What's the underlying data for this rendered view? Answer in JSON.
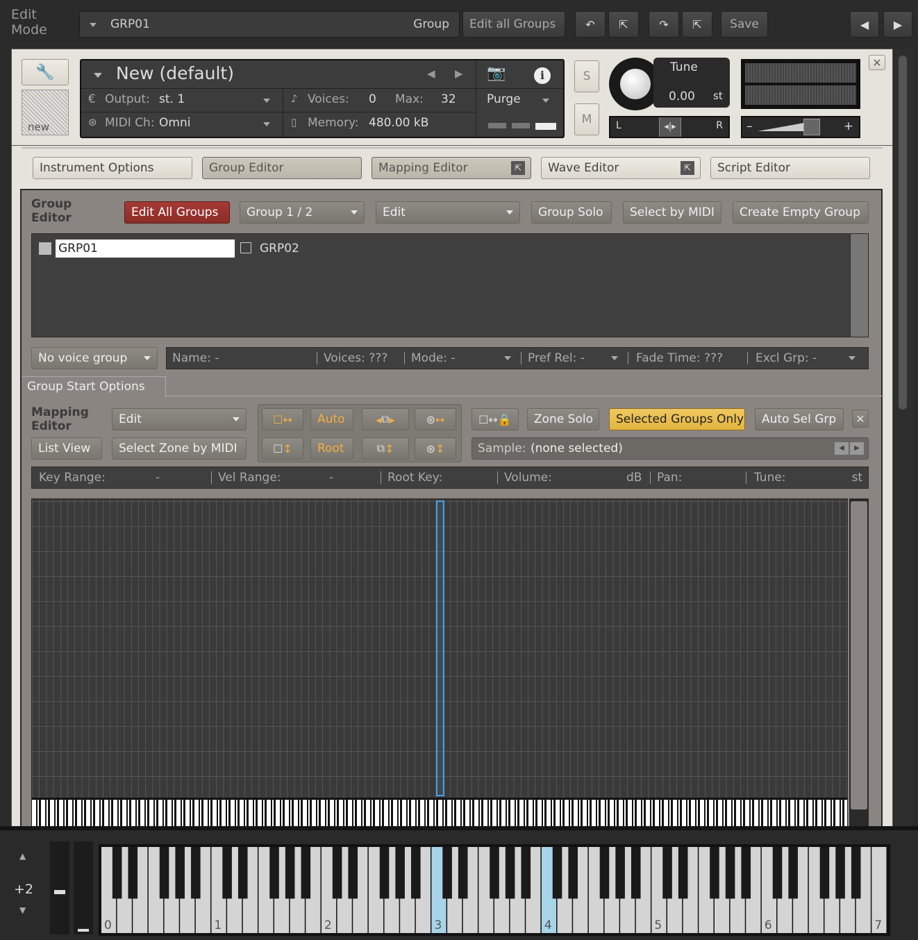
{
  "topbar": {
    "edit_mode": [
      "Edit",
      "Mode"
    ],
    "group_name": "GRP01",
    "group_label": "Group",
    "edit_all_groups": "Edit all Groups",
    "save": "Save"
  },
  "instrument": {
    "name": "New (default)",
    "output_label": "Output:",
    "output_value": "st. 1",
    "midi_label": "MIDI Ch:",
    "midi_value": "Omni",
    "voices_label": "Voices:",
    "voices_value": "0",
    "max_label": "Max:",
    "max_value": "32",
    "memory_label": "Memory:",
    "memory_value": "480.00 kB",
    "purge": "Purge",
    "new_label": "new",
    "solo": "S",
    "mute": "M",
    "tune_label": "Tune",
    "tune_value": "0.00",
    "tune_unit": "st",
    "pan_left": "L",
    "pan_right": "R",
    "volume_minus": "–",
    "volume_plus": "+"
  },
  "tabs": {
    "instrument_options": "Instrument Options",
    "group_editor": "Group Editor",
    "mapping_editor": "Mapping Editor",
    "wave_editor": "Wave Editor",
    "script_editor": "Script Editor"
  },
  "group_editor": {
    "title": [
      "Group",
      "Editor"
    ],
    "edit_all_groups": "Edit All Groups",
    "group_select": "Group 1 / 2",
    "edit": "Edit",
    "group_solo": "Group Solo",
    "select_by_midi": "Select by MIDI",
    "create_empty_group": "Create Empty Group",
    "groups": [
      "GRP01",
      "GRP02"
    ],
    "voice_group": "No voice group",
    "name_label": "Name: -",
    "voices_label": "Voices: ???",
    "mode_label": "Mode: -",
    "pref_rel_label": "Pref Rel: -",
    "fade_time_label": "Fade Time:  ???",
    "excl_grp_label": "Excl Grp:  -",
    "start_options": "Group Start Options"
  },
  "mapping_editor": {
    "title": [
      "Mapping",
      "Editor"
    ],
    "edit": "Edit",
    "list_view": "List View",
    "select_zone_by_midi": "Select Zone by MIDI",
    "auto": "Auto",
    "root": "Root",
    "zone_solo": "Zone Solo",
    "selected_groups_only": "Selected Groups Only",
    "auto_sel_grp": "Auto Sel Grp",
    "sample_label": "Sample:",
    "sample_value": "(none selected)",
    "key_range_label": "Key Range:",
    "key_range_value": "-",
    "vel_range_label": "Vel Range:",
    "vel_range_value": "-",
    "root_key_label": "Root Key:",
    "volume_label": "Volume:",
    "volume_unit": "dB",
    "pan_label": "Pan:",
    "tune_label": "Tune:",
    "tune_unit": "st"
  },
  "keyboard": {
    "octave_shift": "+2",
    "octave_labels": [
      "0",
      "1",
      "2",
      "3",
      "4",
      "5",
      "6",
      "7"
    ],
    "highlighted_octaves": [
      "3",
      "4"
    ]
  }
}
